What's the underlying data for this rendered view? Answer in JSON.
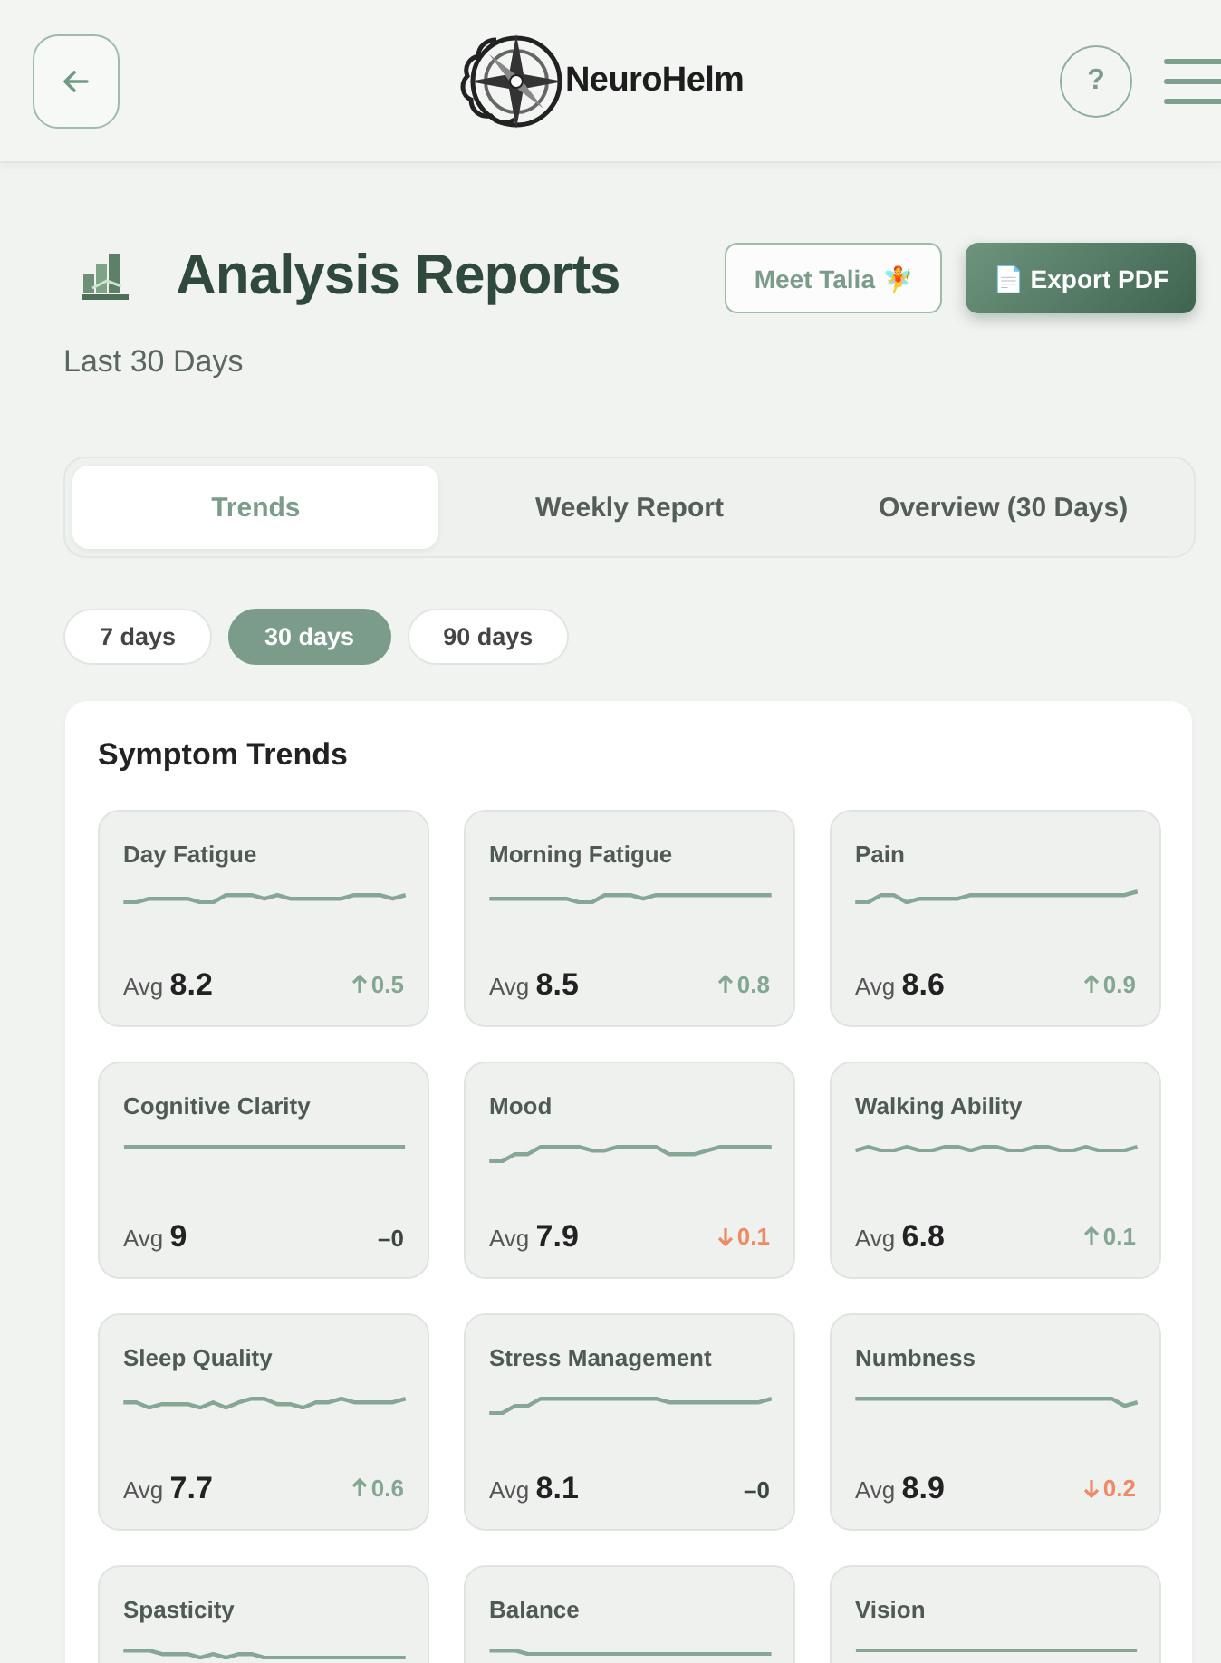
{
  "header": {
    "brand": "NeuroHelm",
    "help_label": "?"
  },
  "page": {
    "title": "Analysis Reports",
    "subtitle": "Last 30 Days"
  },
  "actions": [
    {
      "label": "Meet Talia 🧚",
      "kind": "outline"
    },
    {
      "label": "📄 Export PDF",
      "kind": "primary"
    }
  ],
  "tabs": [
    {
      "label": "Trends",
      "selected": true
    },
    {
      "label": "Weekly Report",
      "selected": false
    },
    {
      "label": "Overview (30 Days)",
      "selected": false
    }
  ],
  "periods": [
    {
      "label": "7 days",
      "selected": false
    },
    {
      "label": "30 days",
      "selected": true
    },
    {
      "label": "90 days",
      "selected": false
    }
  ],
  "symptom_trends": {
    "title": "Symptom Trends",
    "cards": [
      {
        "name": "Day Fatigue",
        "avg_label": "Avg",
        "avg": "8.2",
        "change": "0.5",
        "kind": "up"
      },
      {
        "name": "Morning Fatigue",
        "avg_label": "Avg",
        "avg": "8.5",
        "change": "0.8",
        "kind": "up"
      },
      {
        "name": "Pain",
        "avg_label": "Avg",
        "avg": "8.6",
        "change": "0.9",
        "kind": "up"
      },
      {
        "name": "Cognitive Clarity",
        "avg_label": "Avg",
        "avg": "9",
        "change": "–0",
        "kind": "flat"
      },
      {
        "name": "Mood",
        "avg_label": "Avg",
        "avg": "7.9",
        "change": "0.1",
        "kind": "down"
      },
      {
        "name": "Walking Ability",
        "avg_label": "Avg",
        "avg": "6.8",
        "change": "0.1",
        "kind": "up"
      },
      {
        "name": "Sleep Quality",
        "avg_label": "Avg",
        "avg": "7.7",
        "change": "0.6",
        "kind": "up"
      },
      {
        "name": "Stress Management",
        "avg_label": "Avg",
        "avg": "8.1",
        "change": "–0",
        "kind": "flat"
      },
      {
        "name": "Numbness",
        "avg_label": "Avg",
        "avg": "8.9",
        "change": "0.2",
        "kind": "down"
      },
      {
        "name": "Spasticity"
      },
      {
        "name": "Balance"
      },
      {
        "name": "Vision"
      }
    ]
  }
}
